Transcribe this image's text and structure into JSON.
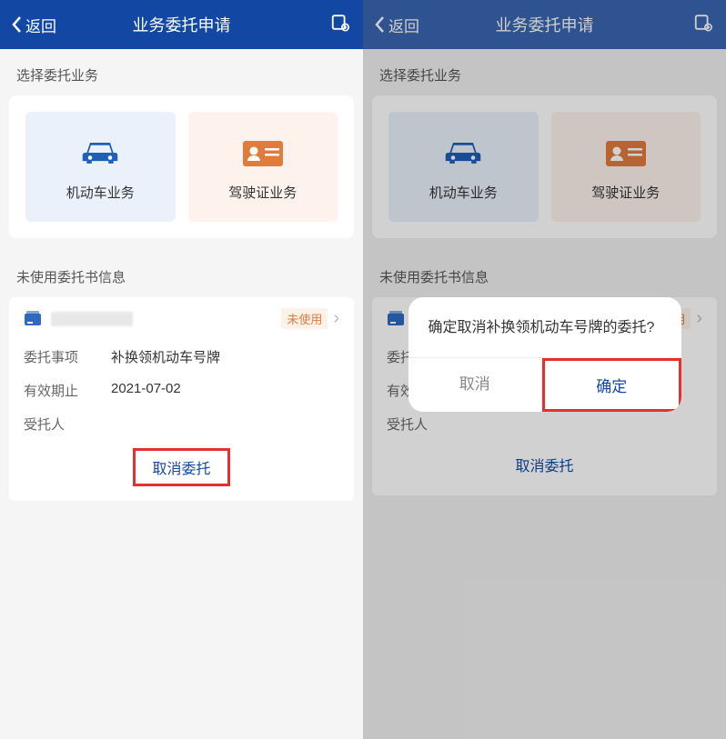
{
  "header": {
    "back_label": "返回",
    "title": "业务委托申请"
  },
  "sections": {
    "select_biz": "选择委托业务",
    "unused_info": "未使用委托书信息"
  },
  "biz": {
    "vehicle": "机动车业务",
    "license": "驾驶证业务"
  },
  "info": {
    "unused_badge": "未使用",
    "matter_label": "委托事项",
    "matter_value": "补换领机动车号牌",
    "expire_label": "有效期止",
    "expire_value": "2021-07-02",
    "trustee_label": "受托人",
    "cancel_link": "取消委托"
  },
  "dialog": {
    "message": "确定取消补换领机动车号牌的委托?",
    "cancel": "取消",
    "confirm": "确定"
  }
}
